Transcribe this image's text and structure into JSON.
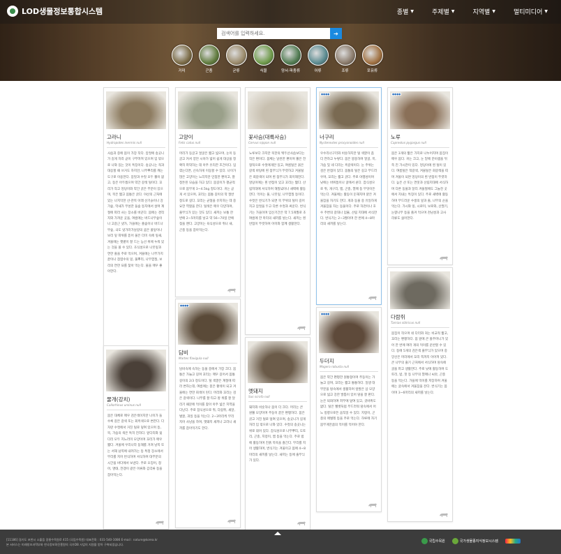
{
  "header": {
    "logo_text": "LOD생물정보통합시스템",
    "nav": [
      "종별",
      "주제별",
      "지역별",
      "멀티미디어"
    ],
    "search_placeholder": "검색어를 입력하세요.",
    "categories": [
      {
        "label": "거미",
        "color": "#7a6a45"
      },
      {
        "label": "곤충",
        "color": "#5f7a3c"
      },
      {
        "label": "균류",
        "color": "#9a8a6a"
      },
      {
        "label": "식물",
        "color": "#6e9a4a"
      },
      {
        "label": "양서·파충류",
        "color": "#4f7a50"
      },
      {
        "label": "어류",
        "color": "#5a8a8f"
      },
      {
        "label": "조류",
        "color": "#8a7a6a"
      },
      {
        "label": "포유류",
        "color": "#a07040"
      }
    ]
  },
  "cards": [
    {
      "name": "고라니",
      "sci": "Hydropotes inermis null",
      "desc": "사슴과 중에 몸이 가장 작다. 암컷에 송곳니가 길게 자라 곧이 구부려져 있으며 입 밖으로 나와 있는 것이 특징이다. 송곳니는 적과 대응할 때 쓰거도 하지만, 나무뿌리를 캐는 도구로 이용한다. 암컷과 수컷 모두 뿔이 없고, 등은 어두웠으며 약간 갈색 털이다. 꼬리가 작고 엉덩이와 약간 굵은 부분이 있으며, 목은 짧고 몸통은 굵다. 야산의 근처에 있는 나지막한 산·관목 아래 산기슭이나 강가숲, 억새가 무성한 들숲 등지에서 살며 계절에 따라 사는 장소를 바꾼다. 봄에는 경작지와 가까운 곳을, 여름에는 버드나무숲이나 고갈근 냇가, 가을에는 졸숲이나 버드나무숲, 국도 냇가러가날갈의 굶은 풀잎이나 보리 잎 따위를 뜯어 물은 더미 속에 잎새, 겨울에는 햇볕이 잘 드는 능선 위에 누워 있는 것을 볼 수 있다. 초식성으로 나뭇잎과 연한 줄을 주로 먹으며, 겨울에는 나무가지 끝이나 참엽수의 잎, 풀뿌리, 나무껍질, 보리의 연한 묘를 찾아 먹는다. 물을 매우 좋아한다.",
      "photo": "#8e7d62"
    },
    {
      "name": "고양이",
      "sci": "Felis catus null",
      "desc": "머리가 둥글고 얼굴은 짧고 넓으며, 눈이 둥글고 커서 양안 시야가 넓어 쉽게 대상을 정확히 파악하는 데 아주 유리한 조건이다. 입 꺾는다면, 신속하게 이동할 수 있다. 나이가 많은 고양이는 느리지만 민첩한 편이고, 잘 정돈된 모습을 하고 있다. 몸길이가 평균적으로 몸무게 3~4.5kg 정도이다. 귀는 곧게 서 있으며, 꼬리는 몸통 길이의 약 절반 정도로 길다. 꼬리는 균형을 유지하는 데 중요한 역할을 한다. 털색은 매우 다양하며, 줄무늬가 있는 것도 있다. 새끼는 보통 한 번에 2~5마리를 낳고 약 56~70일 만에 젖을 뗀다. 고양이는 육식성으로 쥐나 새, 곤충 등을 잡아먹는다.",
      "photo": "#9aa08a"
    },
    {
      "name": "꽃사슴(대륙사슴)",
      "sci": "Cervus nippon null",
      "desc": "노루보다 크지만 북한의 백두산사슴보다는 작은 편이다. 몸체는 날씬한 편이며 뿔은 전형적으로 수컷에게만 있고, 여름털은 붉은 갈색 바탕에 흰 점무늬가 뚜렷하고 겨울털은 회갈색이 되며 흰 점무늬가 희미해진다. 엉덩이에는 흰 반점이 있고 꼬리는 짧다. 산림지대에 서식하며 해질녘이나 새벽에 활동한다. 먹이는 풀, 나뭇잎, 나무껍질 등이다. 수컷은 번식기가 되면 목 부위의 털이 길어지고 암컷을 두고 다른 수컷과 싸운다. 번식기는 가을이며 임신기간은 약 7.5개월로 초여름에 한 마리의 새끼를 낳는다. 새끼는 흰 반점이 뚜렷하며 어미와 함께 생활한다.",
      "photo": "#c8c0b0"
    },
    {
      "name": "너구리",
      "sci": "Nyctereutes procyonoides null",
      "desc": "우수리너구리와 비슷하지만 털 색깔이 좀 더 연하고 누렇다. 몸은 뚱뚱하며 얼굴, 목, 가슴 및 네 다리는 흑갈색이다. 눈 주위는 검은 반점이 있다. 몸통의 털은 길고 부드러우며, 꼬리는 짧고 굵다. 주로 야행성이며 낮에는 바위틈이나 굴에서 쉰다. 잡식성으로 쥐, 개구리, 뱀, 곤충, 열매 등 무엇이든 먹는다. 겨울에는 활동이 둔해지며 얕은 겨울잠을 자기도 한다. 개과 동물 중 유일하게 겨울잠을 자는 동물이다. 주로 하천이나 호수 주변의 갈대나 덤불, 산림 지대에 서식한다. 번식기는 2~3월이며 한 번에 4~8마리의 새끼를 낳는다.",
      "photo": "#7a6a52"
    },
    {
      "name": "노루",
      "sci": "Capreolus pygargus null",
      "desc": "몸은 3개의 짧은 가지로 나누어지며 몸집이 매우 몸다. 귀는 크고, 눈 밑에 분비샘을 뒤쪽 진 가시관이 있다. 엉덩이에 흰 털이 있다. 여름털은 적갈색, 겨울털은 회갈색을 띠며 겨울이 되면 엉덩이의 흰 반점이 뚜렷하다. 높은 산 또는 연못과 산림지대에 서식하며 다른 동물과 달리 겨울철에도 그늘진 곳에서 지내는 특징이 있다. 주로 새벽에 활동하며 부드러운 수생의 잎과 줄, 나무의 순을 먹는다. 가시와 잎, 시로미, 보로와, 산딸기, 눈향나무 등을 즐겨 먹으며 천남성과 고사리류도 싫어한다.",
      "photo": "#8a7058"
    },
    {
      "name": "다람쥐",
      "sci": "Tamias sibiricus null",
      "desc": "몸집이 작으며 네 다리와 귀는 비교적 짧고, 꼬리는 편평하다. 몸 앞에 큰 볼주머니가 있어 한 번에 여러 개의 먹이를 운반할 수 있다. 등에 5개의 검은색 줄무늬가 있으며 중앙선은 머리에서 꼬리 쪽까지 이어져 있다. 큰 나무의 줄기 근처에서 서식하며 땅속에 굴을 파고 생활한다. 주로 낮에 활동하며 도토리, 밤, 잣 등 나무의 열매나 씨앗, 곤충 등을 먹는다. 가을에 먹이를 저장하며 겨울에는 굴속에서 겨울잠을 잔다. 번식기는 봄이며 3~6마리의 새끼를 낳는다.",
      "photo": "#6e6a60"
    },
    {
      "name": "담비",
      "sci": "Martes flavigula null",
      "desc": "담비속에 속하는 동물 중에서 가장 크다. 몸통은 가늘고 길며 꼬리는 매우 길어서 몸통 길이의 2/3 정도이다. 털 색깔은 계절에 따라 변하는데, 여름에는 짙은 황색이 되고 겨울에는 연한 회색이 된다. 머리와 꼬리는 검은 갈색이다. 나무를 잘 타고 땅 위를 잘 달리기 때문에 먹이를 찾아 아주 넓은 지역을 다닌다. 주로 잡식성으로 쥐, 다람쥐, 새알, 벌꿀, 과일 등을 먹는다. 2~3마리씩 무리 지어 사냥을 하며, 멧돼지 새끼나 고라니 새끼를 잡아먹기도 한다.",
      "photo": "#5a4a38"
    },
    {
      "name": "두더지",
      "sci": "Mogera robusta null",
      "desc": "몸은 약간 편평한 원통형이며 주둥이는 가늘고 길며, 꼬리는 짧고 통통하다. 일생 대부분을 땅속에서 생활하며 앞발은 삽 모양으로 넓고 강한 발톱이 있어 땅을 잘 판다. 눈은 퇴화하여 피부에 덮여 있고, 귓바퀴도 없다. 털은 벨벳처럼 부드러워 땅속에서 어느 방향으로든 움직일 수 있다. 지렁이, 곤충의 애벌레 등을 주로 먹는다. 하루에 자기 몸무게만큼의 먹이를 먹어야 한다.",
      "photo": "#5e4a3a"
    },
    {
      "name": "멧돼지",
      "sci": "Sus scrofa null",
      "desc": "돼지와 비슷하나 몸이 더 크다. 머리는 큰 원뿔 모양이며 주둥이 끝은 편평하다. 몸은 굵고 거친 털로 덮여 있으며, 송곳니가 길게 자라 입 밖으로 나와 있다. 수컷의 송곳니는 위로 휘어 있다. 잡식성으로 나무뿌리, 도토리, 곤충, 지렁이, 뱀 등을 먹는다. 주로 밤에 활동하며 진흙 목욕을 즐긴다. 무리를 지어 생활하며, 번식기는 겨울이고 봄에 4~8마리의 새끼를 낳는다. 새끼는 등에 줄무늬가 있다.",
      "photo": "#6a5a48"
    },
    {
      "name": "물개(강치)",
      "sci": "Callorhinus ursinus null",
      "desc": "몸은 대체로 매우 검은색이지만 나이가 들수록 짙은 갈색 또는 회흑색으로 변한다. 다 자란 수컷에서 거친 털로 덮여 있으며 등, 목, 가슴의 색은 특히 진하다. 앞다리와 뒷다리 모두 지느러미 모양이며 꼬리가 매우 짧다. 겨울에 우리나라 동해를 거쳐 남쪽 또는 서해 남쪽에 내려가는 등 특정 장소에서 무리를 지어 번식하며 서식하며 대부분의 시간을 바다에서 보낸다. 주로 오징어, 청어, 명태, 전갱이 같은 어류와 갑각류 등을 잡아먹는다.",
      "photo": "#4a4038"
    }
  ],
  "footer": {
    "line1": "[11186] 경기도 포천시 소흘읍 광릉수목원로 415 (국립수목원) 대표전화 : 031-540-1086 E-mail : nature@korea.kr",
    "line2": "본 서비스는 미래창조과학부와 한국정보화진흥원의 국가DB 사업의 지원을 받아 구축되었습니다.",
    "logos": [
      "국립수목원",
      "국가생물종지식정보시스템"
    ]
  }
}
